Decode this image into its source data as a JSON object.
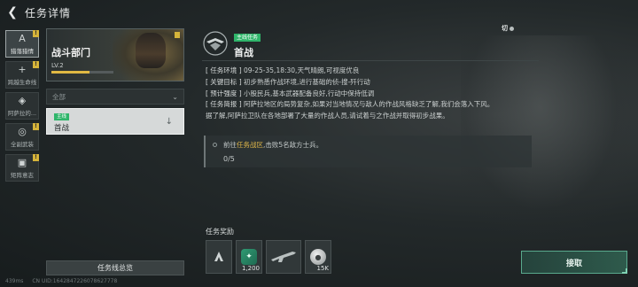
{
  "header": {
    "title": "任务详情"
  },
  "tabs": [
    {
      "label": "猎落猎情",
      "icon": "A",
      "active": true,
      "flag": "!"
    },
    {
      "label": "跨越生命线",
      "icon": "+",
      "active": false,
      "flag": "!"
    },
    {
      "label": "阿萨拉的...",
      "icon": "◈",
      "active": false,
      "flag": ""
    },
    {
      "label": "全副武装",
      "icon": "◎",
      "active": false,
      "flag": "!"
    },
    {
      "label": "矩阵意志",
      "icon": "▣",
      "active": false,
      "flag": "!"
    }
  ],
  "mission_card": {
    "title": "战斗部门",
    "level": "LV.2",
    "progress": 0.62
  },
  "dropdown": {
    "value": "全部"
  },
  "mission_row": {
    "tag": "主线",
    "name": "首战"
  },
  "overview_button": "任务线总览",
  "detail": {
    "tag": "主线任务",
    "title": "首战",
    "env_key": "[ 任务环境 ]",
    "env_val": "09-25-35,18:30,天气晴朗,可视度优良",
    "goal_key": "[ 关键目标 ]",
    "goal_val": "初步熟悉作战环境,进行基础的侦-搜-歼行动",
    "intensity_key": "[ 预计强度 ]",
    "intensity_val": "小股民兵,基本武器配备良好,行动中保持低调",
    "brief_key": "[ 任务简报 ]",
    "brief_val": "阿萨拉地区的局势复杂,如果对当地情况与敌人的作战风格缺乏了解,我们会落入下风。",
    "brief_val2": "据了解,阿萨拉卫队在各地部署了大量的作战人员,请试着与之作战并取得初步战果。"
  },
  "objective": {
    "prefix": "前往",
    "highlight": "任务战区",
    "suffix": ",击败5名敌方士兵。",
    "progress": "0/5"
  },
  "rewards": {
    "label": "任务奖励",
    "items": [
      {
        "icon": "rank-emblem-icon",
        "count": ""
      },
      {
        "icon": "medal-icon",
        "count": "1,200"
      },
      {
        "icon": "rifle-icon",
        "count": ""
      },
      {
        "icon": "coin-icon",
        "count": "15K"
      }
    ]
  },
  "accept_button": "接取",
  "toggle": {
    "label": "切"
  },
  "footer": {
    "ping": "439ms",
    "uid": "CN UID:1642847226078627778"
  }
}
